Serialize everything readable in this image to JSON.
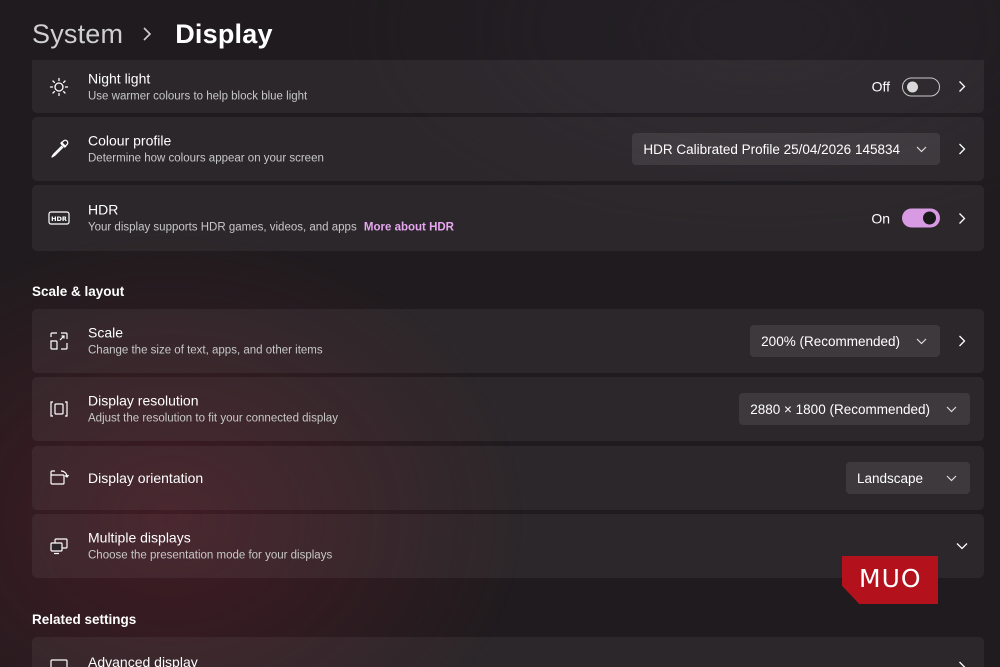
{
  "breadcrumb": {
    "parent": "System",
    "current": "Display"
  },
  "settings": {
    "night_light": {
      "title": "Night light",
      "desc": "Use warmer colours to help block blue light",
      "state": "Off"
    },
    "colour_profile": {
      "title": "Colour profile",
      "desc": "Determine how colours appear on your screen",
      "value": "HDR Calibrated Profile 25/04/2026 145834"
    },
    "hdr": {
      "title": "HDR",
      "desc": "Your display supports HDR games, videos, and apps",
      "link": "More about HDR",
      "state": "On"
    }
  },
  "scale_layout": {
    "header": "Scale & layout",
    "scale": {
      "title": "Scale",
      "desc": "Change the size of text, apps, and other items",
      "value": "200% (Recommended)"
    },
    "resolution": {
      "title": "Display resolution",
      "desc": "Adjust the resolution to fit your connected display",
      "value": "2880 × 1800 (Recommended)"
    },
    "orientation": {
      "title": "Display orientation",
      "value": "Landscape"
    },
    "multiple": {
      "title": "Multiple displays",
      "desc": "Choose the presentation mode for your displays"
    }
  },
  "related": {
    "header": "Related settings",
    "advanced": {
      "title": "Advanced display"
    }
  },
  "watermark": {
    "text": "MUO",
    "color": "#b3121d"
  },
  "colors": {
    "accent": "#d99ae4",
    "link": "#e6a6f0"
  }
}
